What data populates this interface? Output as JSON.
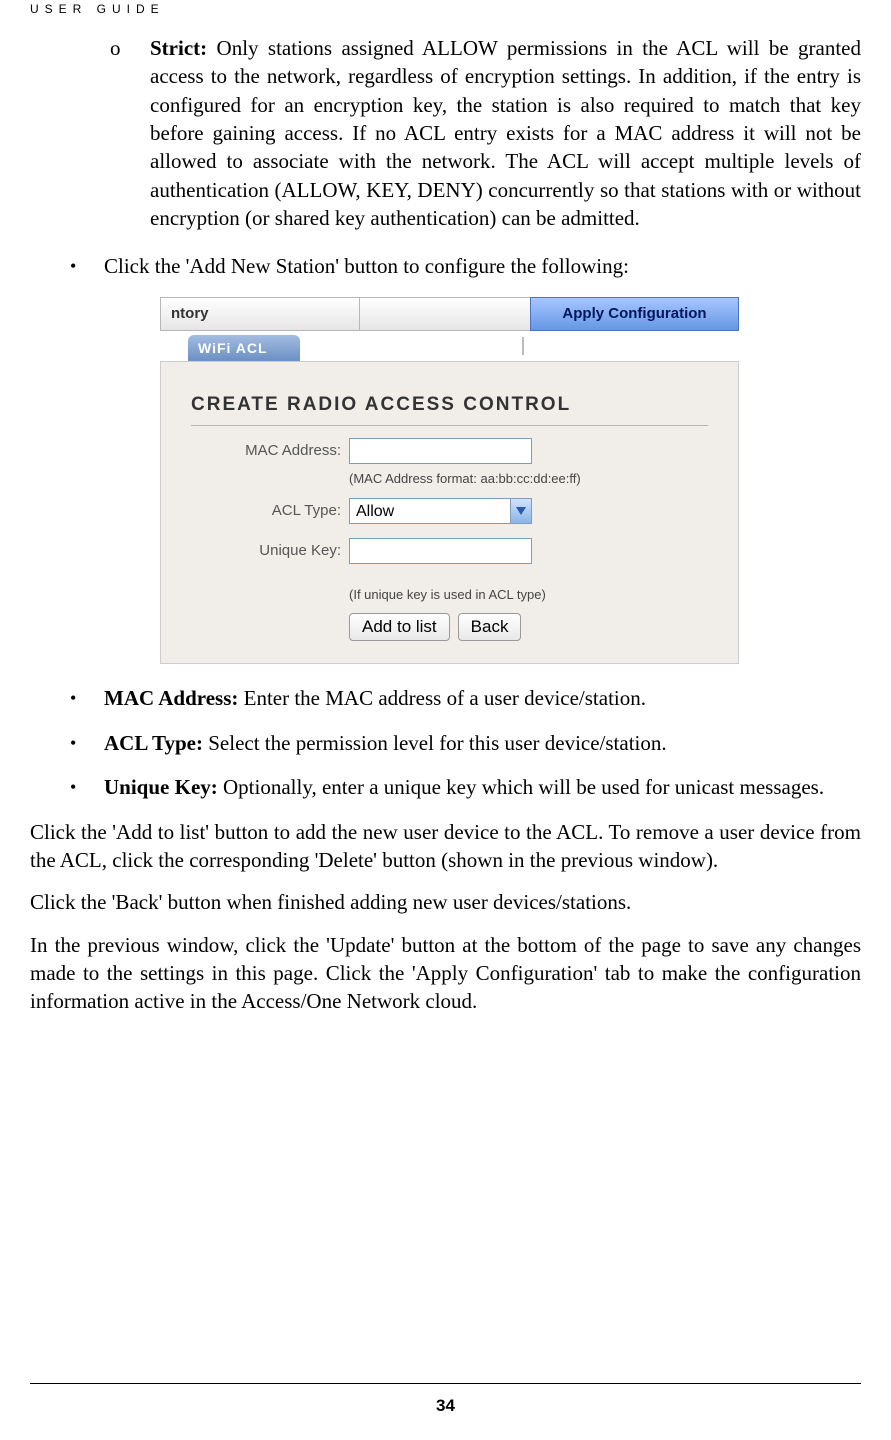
{
  "header": "USER GUIDE",
  "page_number": "34",
  "strict": {
    "label": "Strict:",
    "marker": "o",
    "text": " Only stations assigned ALLOW permissions in the ACL will be granted access to the network, regardless of encryption settings. In addition, if the entry is configured for an encryption key, the station is also required to match that key before gaining access. If no ACL entry exists for a MAC address it will not be allowed to associate with the network. The ACL will accept multiple levels of authentication (ALLOW, KEY, DENY) concurrently so that stations with or without encryption (or shared key authentication) can be admitted."
  },
  "bullet_marker": "•",
  "intro_bullet": "Click the 'Add New Station' button to configure the following:",
  "screenshot": {
    "left_tab": "ntory",
    "apply_tab": "Apply Configuration",
    "wifi_tab": "WiFi ACL",
    "panel_title": "CREATE RADIO ACCESS CONTROL",
    "mac_label": "MAC Address:",
    "mac_value": "",
    "mac_hint": "(MAC Address format: aa:bb:cc:dd:ee:ff)",
    "acl_label": "ACL Type:",
    "acl_value": "Allow",
    "key_label": "Unique Key:",
    "key_value": "",
    "key_hint": "(If unique key is used in ACL type)",
    "btn_add": "Add to list",
    "btn_back": "Back"
  },
  "fields": {
    "mac": {
      "label": "MAC Address:",
      "text": " Enter the MAC address of a user device/station."
    },
    "acl": {
      "label": "ACL Type:",
      "text": " Select the permission level for this user device/station."
    },
    "key": {
      "label": "Unique Key:",
      "text": " Optionally, enter a unique key which will be used for unicast messages."
    }
  },
  "para1": "Click the 'Add to list' button to add the new user device to the ACL. To remove a user device from the ACL, click the corresponding 'Delete' button (shown in the previous window).",
  "para2": "Click the 'Back' button when finished adding new user devices/stations.",
  "para3": "In the previous window, click the 'Update' button at the bottom of the page to save any changes made to the settings in this page. Click the 'Apply Configuration' tab to make the configuration information active in the Access/One Network cloud."
}
